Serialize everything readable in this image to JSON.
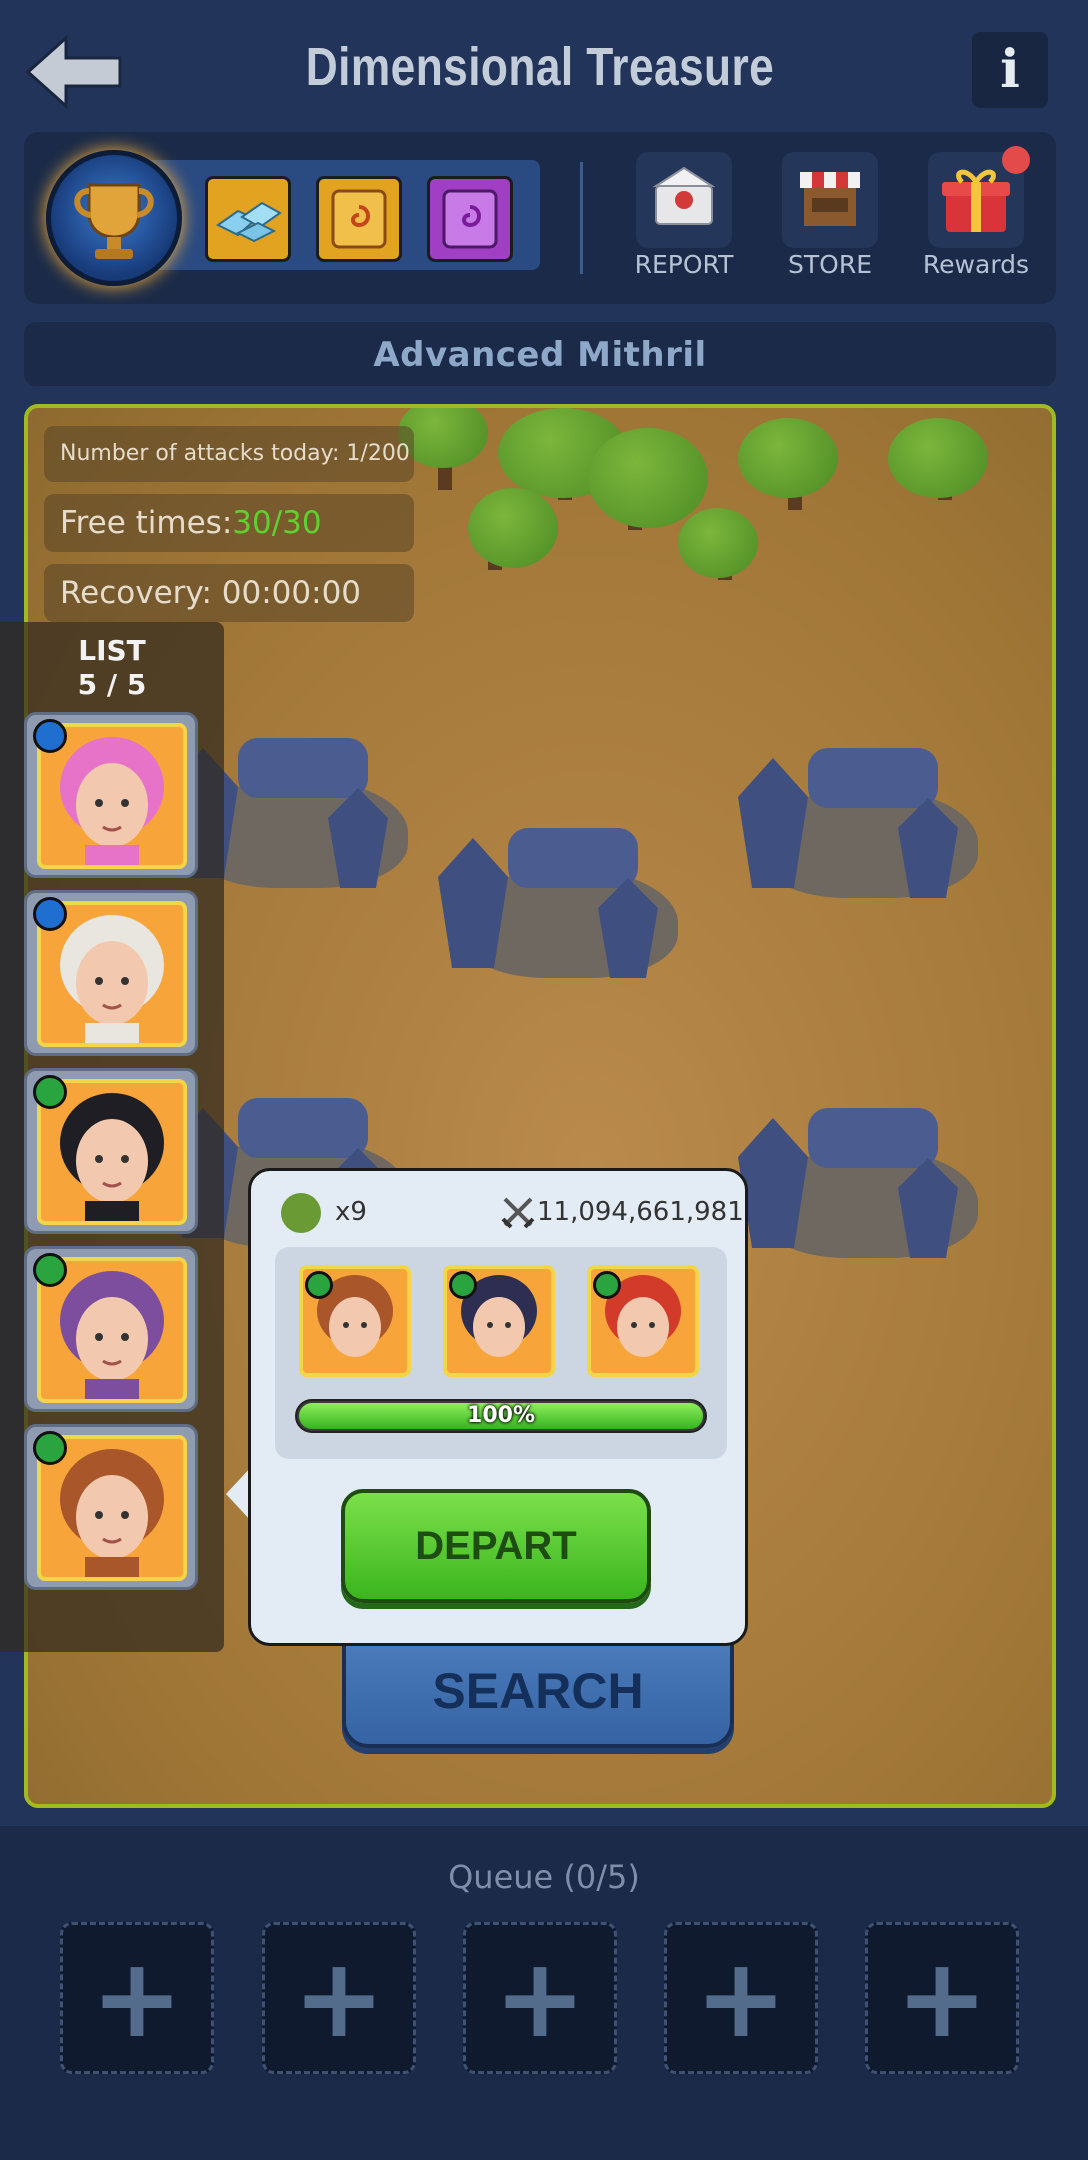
{
  "header": {
    "title": "Dimensional Treasure",
    "info_label": "i"
  },
  "top_panel": {
    "reward_items": [
      "trophy-icon",
      "ore-icon",
      "gold-scroll-icon",
      "purple-scroll-icon"
    ],
    "buttons": [
      {
        "label": "REPORT",
        "icon": "report-icon"
      },
      {
        "label": "STORE",
        "icon": "store-icon"
      },
      {
        "label": "Rewards",
        "icon": "gift-icon",
        "notification": true
      }
    ]
  },
  "subtitle": "Advanced Mithril",
  "map": {
    "attacks_text": "Number of attacks today: 1/200",
    "free_label": "Free times:",
    "free_value": "30/30",
    "recovery_text": "Recovery: 00:00:00"
  },
  "list": {
    "title": "LIST",
    "count": "5 / 5",
    "heroes": [
      {
        "element": "ice",
        "hair": "#e673c8",
        "bg": "#f7a53a"
      },
      {
        "element": "ice",
        "hair": "#e9e5df",
        "bg": "#f7a53a"
      },
      {
        "element": "poison",
        "hair": "#1e1e24",
        "bg": "#f7a53a"
      },
      {
        "element": "poison",
        "hair": "#7d4d9e",
        "bg": "#f7a53a"
      },
      {
        "element": "poison",
        "hair": "#a8562a",
        "bg": "#f7a53a"
      }
    ]
  },
  "popup": {
    "troops": "x9",
    "power": "11,094,661,981",
    "team": [
      {
        "element": "poison",
        "bg": "#f7a53a"
      },
      {
        "element": "poison",
        "bg": "#f7a53a"
      },
      {
        "element": "poison",
        "bg": "#f7a53a"
      }
    ],
    "progress_percent": 100,
    "progress_label": "100%",
    "depart_label": "DEPART"
  },
  "search_label": "SEARCH",
  "queue": {
    "label": "Queue (0/5)",
    "slots": [
      "+",
      "+",
      "+",
      "+",
      "+"
    ]
  },
  "colors": {
    "accent_green": "#5ed12e",
    "map_border": "#a2ba22",
    "background": "#22345a"
  }
}
